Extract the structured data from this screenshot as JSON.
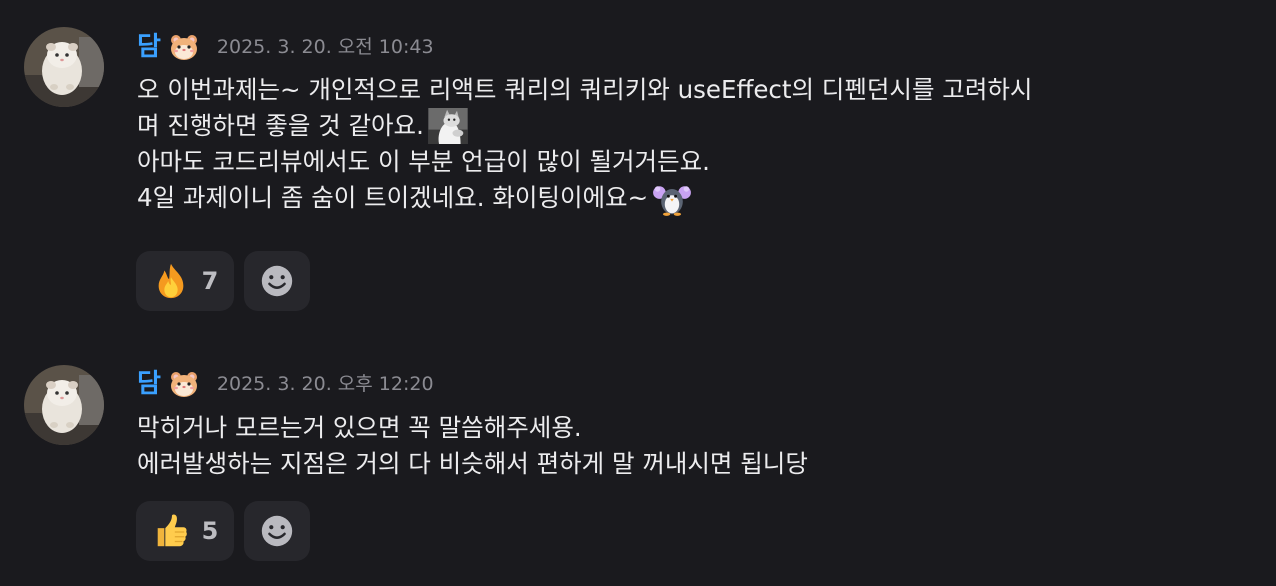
{
  "messages": [
    {
      "username": "담",
      "timestamp": "2025. 3. 20. 오전 10:43",
      "lines": [
        "오 이번과제는~ 개인적으로 리액트 쿼리의 쿼리키와 useEffect의 디펜던시를 고려하시",
        "며 진행하면 좋을 것 같아요.",
        "아마도 코드리뷰에서도 이 부분 언급이 많이 될거거든요.",
        "4일 과제이니 좀 숨이 트이겠네요. 화이팅이에요~"
      ],
      "inline_emojis": [
        "cat-emoji",
        "cheering-penguin-emoji"
      ],
      "reactions": [
        {
          "icon": "fire-icon",
          "count": "7"
        }
      ],
      "add_reaction_icon": "smiley-add-icon"
    },
    {
      "username": "담",
      "timestamp": "2025. 3. 20. 오후 12:20",
      "lines": [
        "막히거나 모르는거 있으면 꼭 말씀해주세용.",
        "에러발생하는 지점은 거의 다 비슷해서 편하게 말 꺼내시면 됩니당"
      ],
      "reactions": [
        {
          "icon": "thumbs-up-icon",
          "count": "5"
        }
      ],
      "add_reaction_icon": "smiley-add-icon"
    }
  ],
  "colors": {
    "background": "#1a1a1e",
    "username": "#3aa0ff",
    "timestamp": "#8b8b92",
    "reaction_bg": "#27272c"
  }
}
